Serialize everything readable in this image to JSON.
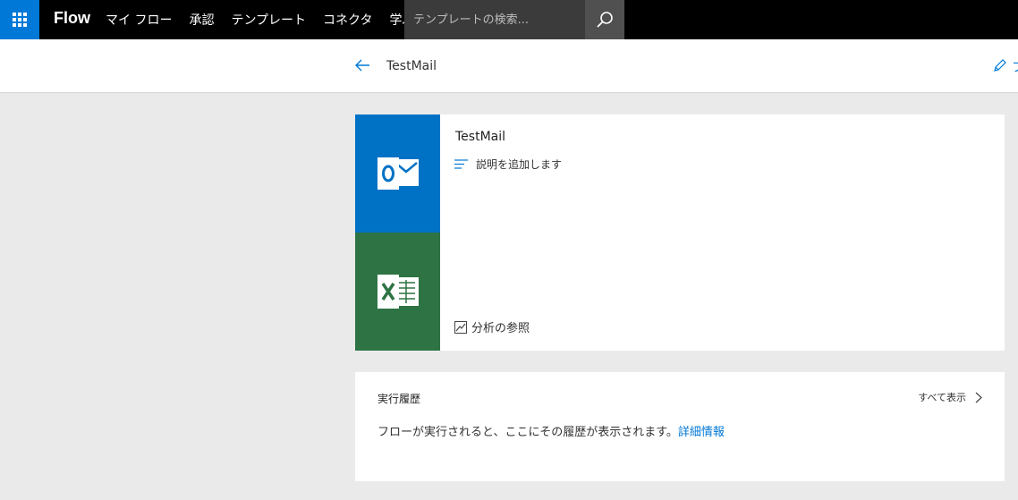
{
  "topbar": {
    "brand": "Flow",
    "nav": [
      "マイ フロー",
      "承認",
      "テンプレート",
      "コネクタ",
      "学ぶ"
    ],
    "search_placeholder": "テンプレートの検索..."
  },
  "subheader": {
    "title": "TestMail",
    "edit_label": "フ"
  },
  "flow": {
    "name": "TestMail",
    "add_description": "説明を追加します",
    "analytics": "分析の参照",
    "connectors": [
      {
        "name": "Outlook",
        "icon": "outlook-icon",
        "color": "#0072c6"
      },
      {
        "name": "Excel",
        "icon": "excel-icon",
        "color": "#2e7344"
      }
    ]
  },
  "history": {
    "title": "実行履歴",
    "see_all": "すべて表示",
    "message": "フローが実行されると、ここにその履歴が表示されます。",
    "link": "詳細情報"
  },
  "colors": {
    "accent": "#0078d7",
    "topbar": "#000000",
    "waffle": "#0078d7"
  }
}
